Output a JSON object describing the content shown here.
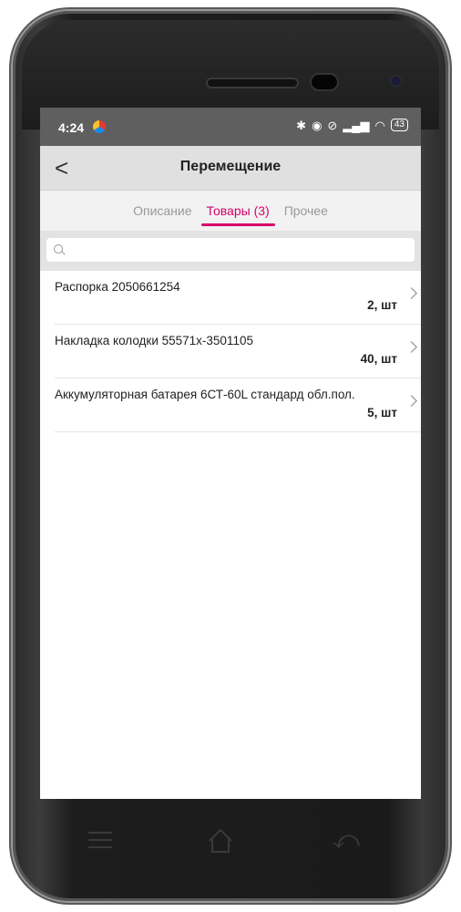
{
  "status_bar": {
    "time": "4:24",
    "battery": "43"
  },
  "header": {
    "title": "Перемещение",
    "back_label": "<"
  },
  "tabs": [
    {
      "label": "Описание",
      "active": false
    },
    {
      "label": "Товары (3)",
      "active": true
    },
    {
      "label": "Прочее",
      "active": false
    }
  ],
  "search": {
    "placeholder": "",
    "value": ""
  },
  "items": [
    {
      "name": "Распорка 2050661254",
      "qty": "2, шт"
    },
    {
      "name": "Накладка колодки 55571х-3501105",
      "qty": "40, шт"
    },
    {
      "name": "Аккумуляторная батарея 6СТ-60L стандард обл.пол.",
      "qty": "5, шт"
    }
  ],
  "colors": {
    "accent": "#d6006b",
    "status_bar": "#5f5f5f",
    "header_bg": "#e0e0e0"
  },
  "icons": {
    "back": "chevron-left-icon",
    "search": "search-icon",
    "item": "chevron-right-icon",
    "nav_menu": "menu-icon",
    "nav_home": "home-icon",
    "nav_back": "back-arrow-icon"
  }
}
